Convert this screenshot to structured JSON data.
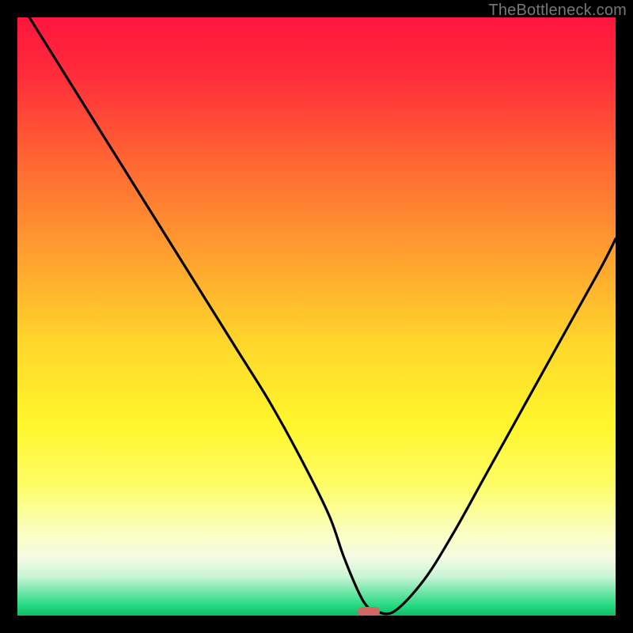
{
  "watermark": "TheBottleneck.com",
  "gradient_stops": [
    {
      "offset": 0.0,
      "color": "#ff153e"
    },
    {
      "offset": 0.1,
      "color": "#ff2e3a"
    },
    {
      "offset": 0.25,
      "color": "#ff6a33"
    },
    {
      "offset": 0.4,
      "color": "#ffa12f"
    },
    {
      "offset": 0.55,
      "color": "#ffd82b"
    },
    {
      "offset": 0.68,
      "color": "#fff62c"
    },
    {
      "offset": 0.78,
      "color": "#fdfd64"
    },
    {
      "offset": 0.86,
      "color": "#fafec0"
    },
    {
      "offset": 0.905,
      "color": "#f3fbe3"
    },
    {
      "offset": 0.935,
      "color": "#c8f4d6"
    },
    {
      "offset": 0.96,
      "color": "#72e6a9"
    },
    {
      "offset": 0.985,
      "color": "#1fd87e"
    },
    {
      "offset": 1.0,
      "color": "#14b866"
    }
  ],
  "chart_data": {
    "type": "line",
    "title": "",
    "xlabel": "",
    "ylabel": "",
    "xlim": [
      0,
      100
    ],
    "ylim": [
      0,
      100
    ],
    "series": [
      {
        "name": "bottleneck-curve",
        "x": [
          2,
          7,
          12,
          17,
          22,
          27,
          32,
          37,
          42,
          47,
          52,
          54.5,
          57,
          58.5,
          60,
          63,
          68,
          73,
          78,
          83,
          88,
          93,
          98,
          100
        ],
        "y": [
          100,
          92,
          84,
          76,
          68,
          60,
          52,
          44,
          36,
          27,
          17,
          10,
          4,
          1.5,
          0.7,
          0.7,
          6,
          14,
          23,
          32,
          41,
          50,
          59,
          63
        ]
      }
    ],
    "marker": {
      "x": 58.7,
      "y": 0.7,
      "color": "#cf6a60"
    },
    "grid": false,
    "legend": false
  }
}
